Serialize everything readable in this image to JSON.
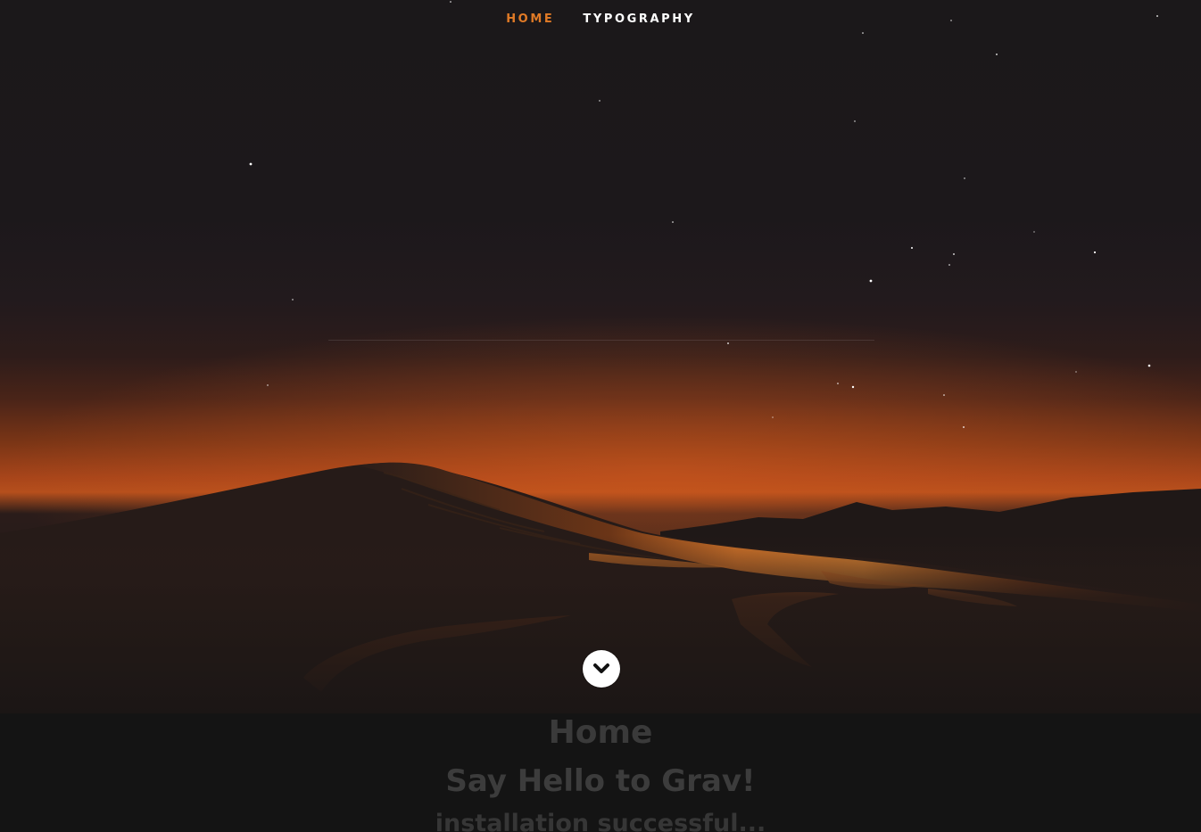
{
  "nav": {
    "items": [
      {
        "label": "HOME",
        "active": true
      },
      {
        "label": "TYPOGRAPHY",
        "active": false
      }
    ]
  },
  "hero": {
    "scroll_icon": "chevron-down-icon"
  },
  "content": {
    "title": "Home",
    "heading": "Say Hello to Grav!",
    "subheading": "installation successful..."
  },
  "colors": {
    "accent": "#e07a26",
    "nav_text": "#ffffff",
    "content_bg": "#141414",
    "content_text": "#3a3a3a"
  }
}
